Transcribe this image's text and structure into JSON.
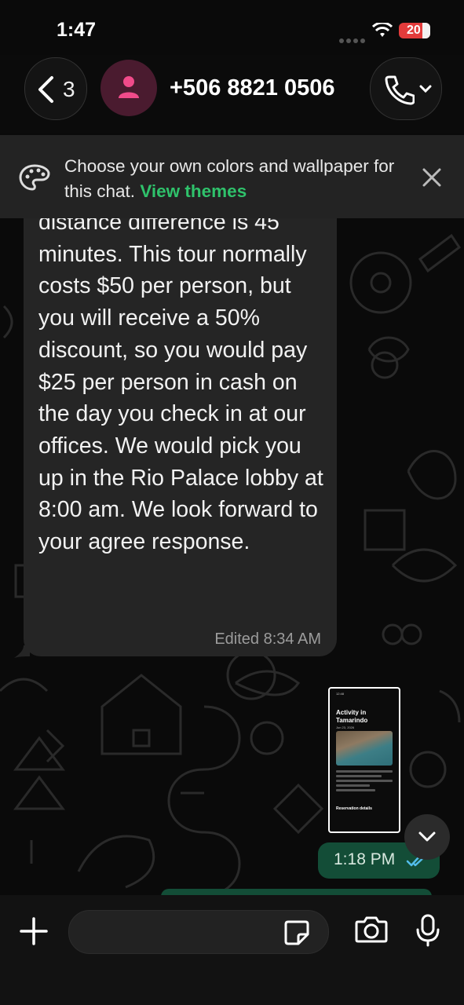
{
  "status_bar": {
    "time": "1:47",
    "battery": "20"
  },
  "header": {
    "back_count": "3",
    "contact_name": "+506 8821 0506"
  },
  "banner": {
    "text": "Choose your own colors and wallpaper for this chat.",
    "link": "View themes"
  },
  "messages": {
    "incoming": {
      "text": "distance difference is 45 minutes. This tour normally costs $50 per person, but you will receive a 50% discount, so you would pay $25 per person in cash on the day you check in at our offices. We would pick you up in the Rio Palace lobby at 8:00 am. We look forward to your agree response.",
      "meta": "Edited 8:34 AM"
    },
    "outgoing_image": {
      "title": "Activity in Tamarindo",
      "date": "Jun 23, 2026",
      "section": "Reservation details",
      "top_time": "12:48"
    },
    "outgoing_time": "1:18 PM"
  },
  "composer": {
    "placeholder": ""
  },
  "colors": {
    "accent": "#2fc26b",
    "outgoing_bubble": "#134d37",
    "incoming_bubble": "#252525"
  }
}
